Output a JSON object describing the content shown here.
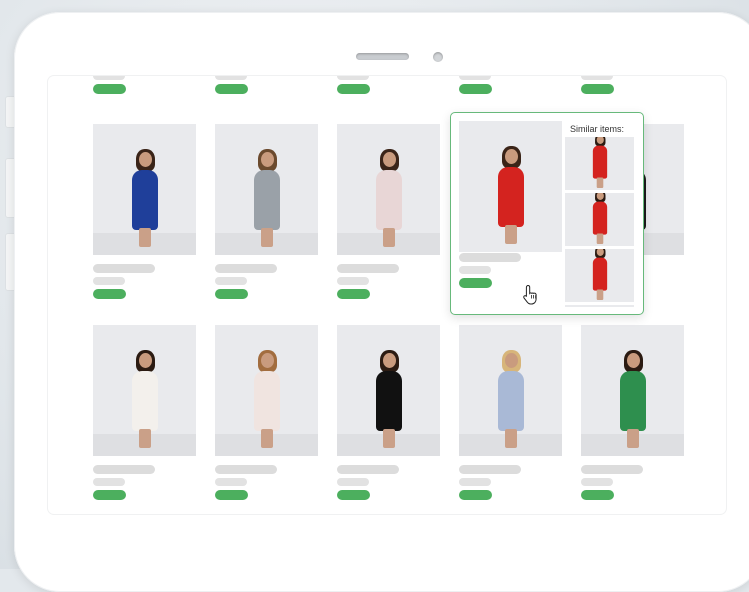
{
  "popup": {
    "similar_title": "Similar items:"
  },
  "colors": {
    "accent_green": "#4caf5e",
    "popup_border": "#67b97b",
    "placeholder_bar": "#dcdcdc"
  },
  "icons": {
    "cursor": "hand-pointer-icon"
  },
  "row1_items": [
    {
      "dress": "#1f3f9a",
      "hair": "#3a2418"
    },
    {
      "dress": "#9aa1a8",
      "hair": "#6b4a2e"
    },
    {
      "dress": "#e8d6d6",
      "hair": "#3a2418"
    },
    {
      "dress": "#d4231f",
      "hair": "#3a2418"
    },
    {
      "dress": "#1a1a1a",
      "hair": "#2b1b12"
    }
  ],
  "row2_items": [
    {
      "dress": "#f3f0ec",
      "hair": "#2b1b12"
    },
    {
      "dress": "#f0e4e0",
      "hair": "#a26d3f"
    },
    {
      "dress": "#111111",
      "hair": "#2b1b12"
    },
    {
      "dress": "#a9b9d6",
      "hair": "#d7b57a"
    },
    {
      "dress": "#2e8f4e",
      "hair": "#2b1b12"
    }
  ],
  "similar_items": [
    {
      "dress": "#d4231f",
      "hair": "#2b1b12"
    },
    {
      "dress": "#d4231f",
      "hair": "#2b1b12"
    },
    {
      "dress": "#d4231f",
      "hair": "#2b1b12"
    }
  ]
}
